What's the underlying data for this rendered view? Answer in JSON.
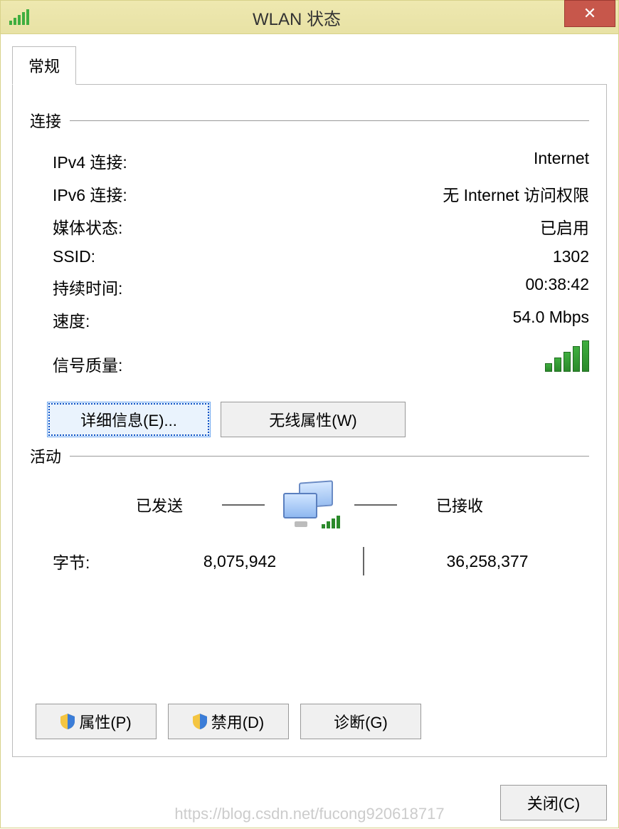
{
  "title": "WLAN 状态",
  "tab": {
    "general": "常规"
  },
  "connection": {
    "header": "连接",
    "ipv4_label": "IPv4 连接:",
    "ipv4_value": "Internet",
    "ipv6_label": "IPv6 连接:",
    "ipv6_value": "无 Internet 访问权限",
    "media_label": "媒体状态:",
    "media_value": "已启用",
    "ssid_label": "SSID:",
    "ssid_value": "1302",
    "duration_label": "持续时间:",
    "duration_value": "00:38:42",
    "speed_label": "速度:",
    "speed_value": "54.0 Mbps",
    "signal_label": "信号质量:"
  },
  "buttons": {
    "details": "详细信息(E)...",
    "wireless_props": "无线属性(W)",
    "properties": "属性(P)",
    "disable": "禁用(D)",
    "diagnose": "诊断(G)",
    "close": "关闭(C)"
  },
  "activity": {
    "header": "活动",
    "sent": "已发送",
    "received": "已接收",
    "bytes_label": "字节:",
    "sent_bytes": "8,075,942",
    "received_bytes": "36,258,377"
  },
  "watermark": "https://blog.csdn.net/fucong920618717"
}
